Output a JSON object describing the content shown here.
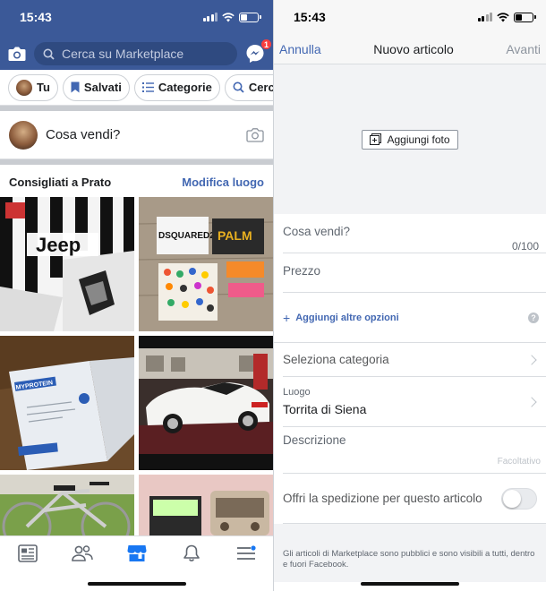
{
  "colors": {
    "fb_blue": "#3b5998",
    "link_blue": "#4267b2",
    "badge_red": "#fa3e3e"
  },
  "left": {
    "status": {
      "time": "15:43"
    },
    "search": {
      "placeholder": "Cerca su Marketplace",
      "icon": "search-icon"
    },
    "messenger": {
      "badge": "1",
      "icon": "messenger-icon"
    },
    "chips": [
      {
        "label": "Tu",
        "icon": "avatar"
      },
      {
        "label": "Salvati",
        "icon": "bookmark-icon"
      },
      {
        "label": "Categorie",
        "icon": "list-icon"
      },
      {
        "label": "Cerca",
        "icon": "search-icon"
      }
    ],
    "sell": {
      "placeholder": "Cosa vendi?",
      "icon": "camera-icon"
    },
    "recommended": {
      "title": "Consigliati a Prato",
      "action": "Modifica luogo"
    },
    "listings": [
      {
        "text": "Jeep",
        "subject": "juventus-jersey"
      },
      {
        "text": "DSQUARED2",
        "text2": "PALM",
        "subject": "clothing-items"
      },
      {
        "text": "MYPROTEIN",
        "subject": "protein-bag"
      },
      {
        "subject": "white-convertible-car"
      },
      {
        "subject": "bicycle"
      },
      {
        "subject": "vintage-radio"
      }
    ],
    "tabbar": [
      "news-feed-icon",
      "friends-icon",
      "marketplace-icon",
      "bell-icon",
      "menu-icon"
    ]
  },
  "right": {
    "status": {
      "time": "15:43"
    },
    "nav": {
      "cancel": "Annulla",
      "title": "Nuovo articolo",
      "next": "Avanti"
    },
    "add_photo": "Aggiungi foto",
    "what_selling": {
      "label": "Cosa vendi?",
      "counter": "0/100"
    },
    "price": {
      "label": "Prezzo"
    },
    "more_options": "Aggiungi altre opzioni",
    "help": "?",
    "category": {
      "label": "Seleziona categoria"
    },
    "location": {
      "label": "Luogo",
      "value": "Torrita di Siena"
    },
    "description": {
      "label": "Descrizione",
      "hint": "Facoltativo"
    },
    "shipping": {
      "label": "Offri la spedizione per questo articolo",
      "enabled": false
    },
    "footer": "Gli articoli di Marketplace sono pubblici e sono visibili a tutti, dentro e fuori Facebook."
  }
}
